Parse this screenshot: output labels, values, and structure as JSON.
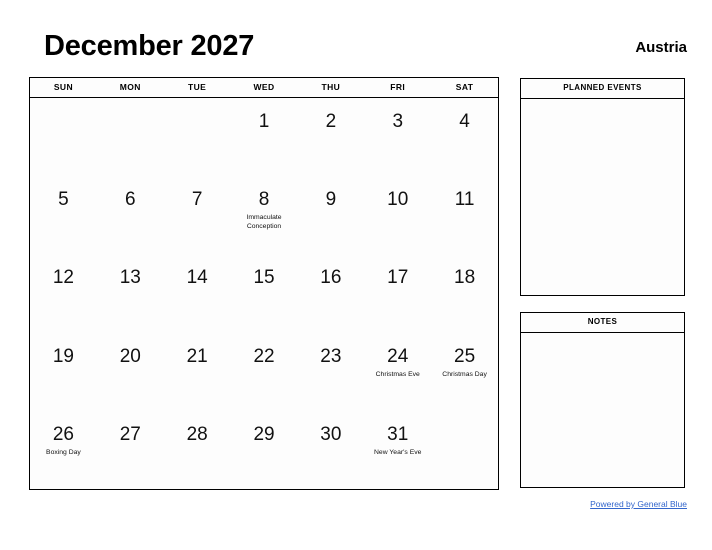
{
  "header": {
    "title": "December 2027",
    "country": "Austria"
  },
  "calendar": {
    "weekdays": [
      "SUN",
      "MON",
      "TUE",
      "WED",
      "THU",
      "FRI",
      "SAT"
    ],
    "weeks": [
      [
        {
          "day": "",
          "event": ""
        },
        {
          "day": "",
          "event": ""
        },
        {
          "day": "",
          "event": ""
        },
        {
          "day": "1",
          "event": ""
        },
        {
          "day": "2",
          "event": ""
        },
        {
          "day": "3",
          "event": ""
        },
        {
          "day": "4",
          "event": ""
        }
      ],
      [
        {
          "day": "5",
          "event": ""
        },
        {
          "day": "6",
          "event": ""
        },
        {
          "day": "7",
          "event": ""
        },
        {
          "day": "8",
          "event": "Immaculate Conception"
        },
        {
          "day": "9",
          "event": ""
        },
        {
          "day": "10",
          "event": ""
        },
        {
          "day": "11",
          "event": ""
        }
      ],
      [
        {
          "day": "12",
          "event": ""
        },
        {
          "day": "13",
          "event": ""
        },
        {
          "day": "14",
          "event": ""
        },
        {
          "day": "15",
          "event": ""
        },
        {
          "day": "16",
          "event": ""
        },
        {
          "day": "17",
          "event": ""
        },
        {
          "day": "18",
          "event": ""
        }
      ],
      [
        {
          "day": "19",
          "event": ""
        },
        {
          "day": "20",
          "event": ""
        },
        {
          "day": "21",
          "event": ""
        },
        {
          "day": "22",
          "event": ""
        },
        {
          "day": "23",
          "event": ""
        },
        {
          "day": "24",
          "event": "Christmas Eve"
        },
        {
          "day": "25",
          "event": "Christmas Day"
        }
      ],
      [
        {
          "day": "26",
          "event": "Boxing Day"
        },
        {
          "day": "27",
          "event": ""
        },
        {
          "day": "28",
          "event": ""
        },
        {
          "day": "29",
          "event": ""
        },
        {
          "day": "30",
          "event": ""
        },
        {
          "day": "31",
          "event": "New Year's Eve"
        },
        {
          "day": "",
          "event": ""
        }
      ]
    ]
  },
  "panels": {
    "planned_events": {
      "title": "PLANNED EVENTS",
      "content": ""
    },
    "notes": {
      "title": "NOTES",
      "content": ""
    }
  },
  "footer": {
    "link_text": "Powered by General Blue",
    "link_color": "#3366cc"
  }
}
